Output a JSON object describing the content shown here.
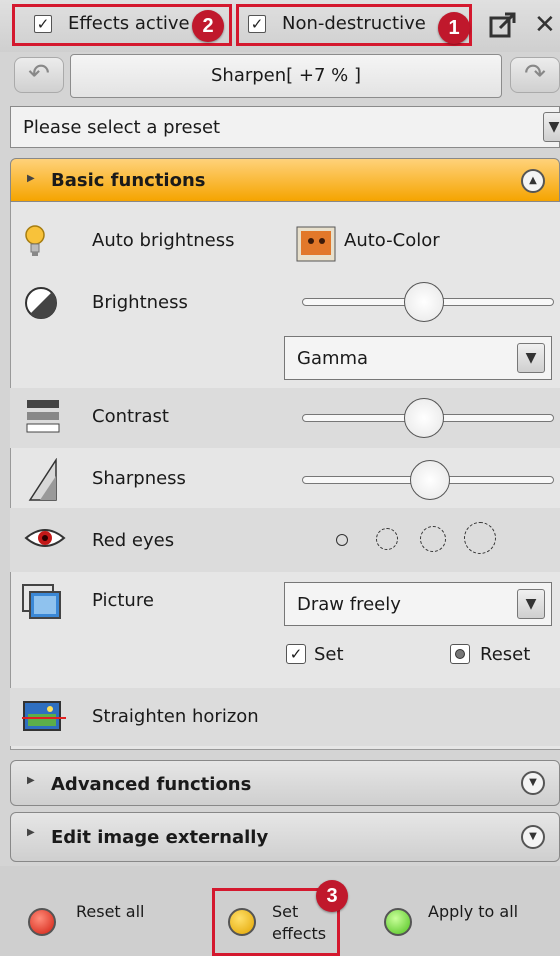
{
  "topbar": {
    "effects_active": {
      "label": "Effects active",
      "checked": true,
      "badge": "2"
    },
    "non_destructive": {
      "label": "Non-destructive",
      "checked": true,
      "badge": "1"
    },
    "expand_icon": "external-window-icon",
    "close_icon": "close-icon"
  },
  "history": {
    "undo_icon": "undo-arrow-icon",
    "redo_icon": "redo-arrow-icon",
    "current": "Sharpen[  +7 % ]"
  },
  "preset": {
    "placeholder": "Please select a preset"
  },
  "sections": {
    "basic": "Basic functions",
    "advanced": "Advanced functions",
    "external": "Edit image externally"
  },
  "basic": {
    "auto_brightness": "Auto brightness",
    "auto_color": "Auto-Color",
    "brightness": "Brightness",
    "brightness_level": 0.5,
    "brightness_mode": "Gamma",
    "contrast": "Contrast",
    "contrast_level": 0.5,
    "sharpness": "Sharpness",
    "sharpness_level": 0.55,
    "red_eyes": "Red eyes",
    "picture_frame": "Picture",
    "draw_mode": "Draw freely",
    "set": "Set",
    "reset": "Reset",
    "straighten": "Straighten horizon"
  },
  "footer": {
    "reset_all": "Reset all",
    "set_effects_1": "Set",
    "set_effects_2": "effects",
    "set_effects_badge": "3",
    "apply_to_all": "Apply to all"
  },
  "colors": {
    "accent_orange": "#f5a400",
    "highlight_red": "#d4182e"
  }
}
